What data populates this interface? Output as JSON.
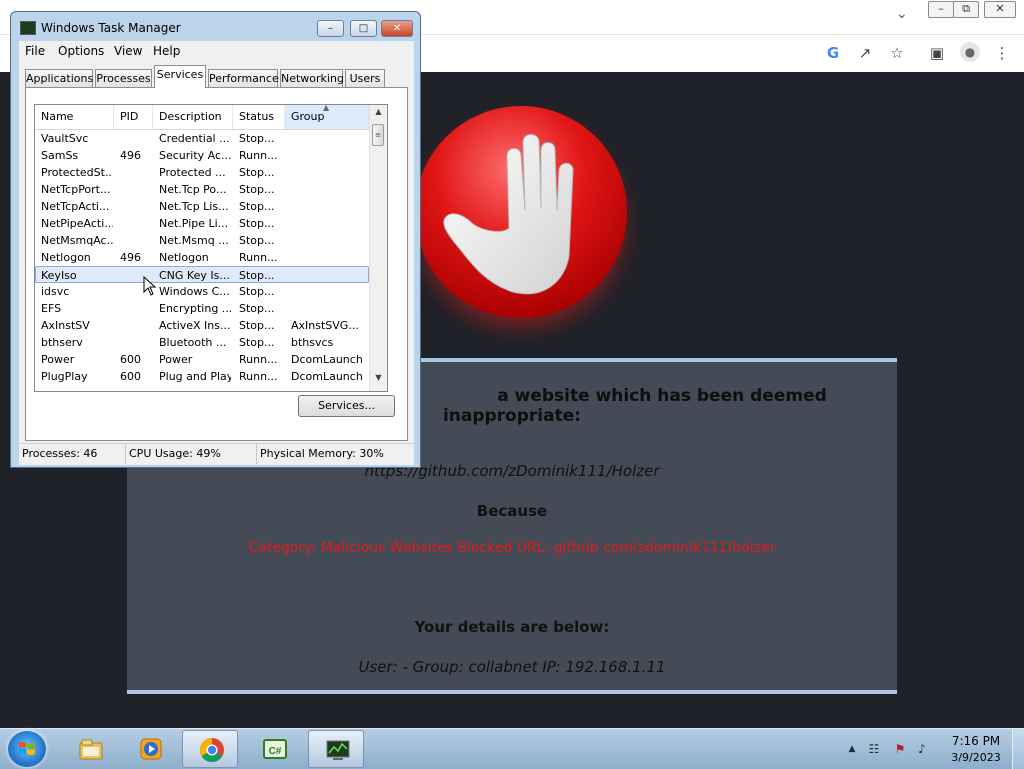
{
  "browser": {
    "window_controls": {
      "minimize": "–",
      "restore": "⧉",
      "close": "✕"
    },
    "tab_dropdown": "⌄",
    "toolbar_icons": [
      "google-icon",
      "share-icon",
      "star-icon",
      "sidepanel-icon",
      "profile-icon",
      "menu-icon"
    ],
    "toolbar_glyphs": {
      "google": "G",
      "share": "↗",
      "star": "☆",
      "sidepanel": "▣",
      "profile": "●",
      "menu": "⋮"
    }
  },
  "block_page": {
    "title": "a website which has been deemed inappropriate:",
    "url": "https://github.com/zDominik111/Holzer",
    "because": "Because",
    "reason": "Category: Malicious Websites   Blocked URL: github.com/zdominik111/holzer",
    "details_heading": "Your details are below:",
    "details": "User: -    Group: collabnet    IP: 192.168.1.11"
  },
  "task_manager": {
    "title": "Windows Task Manager",
    "menu": [
      "File",
      "Options",
      "View",
      "Help"
    ],
    "tabs": [
      "Applications",
      "Processes",
      "Services",
      "Performance",
      "Networking",
      "Users"
    ],
    "active_tab": "Services",
    "columns": [
      "Name",
      "PID",
      "Description",
      "Status",
      "Group"
    ],
    "rows": [
      {
        "name": "VaultSvc",
        "pid": "",
        "description": "Credential ...",
        "status": "Stop...",
        "group": ""
      },
      {
        "name": "SamSs",
        "pid": "496",
        "description": "Security Ac...",
        "status": "Runn...",
        "group": ""
      },
      {
        "name": "ProtectedSt...",
        "pid": "",
        "description": "Protected ...",
        "status": "Stop...",
        "group": ""
      },
      {
        "name": "NetTcpPort...",
        "pid": "",
        "description": "Net.Tcp Po...",
        "status": "Stop...",
        "group": ""
      },
      {
        "name": "NetTcpActi...",
        "pid": "",
        "description": "Net.Tcp Lis...",
        "status": "Stop...",
        "group": ""
      },
      {
        "name": "NetPipeActi...",
        "pid": "",
        "description": "Net.Pipe Li...",
        "status": "Stop...",
        "group": ""
      },
      {
        "name": "NetMsmqAc...",
        "pid": "",
        "description": "Net.Msmq ...",
        "status": "Stop...",
        "group": ""
      },
      {
        "name": "Netlogon",
        "pid": "496",
        "description": "Netlogon",
        "status": "Runn...",
        "group": ""
      },
      {
        "name": "KeyIso",
        "pid": "",
        "description": "CNG Key Is...",
        "status": "Stop...",
        "group": "",
        "selected": true
      },
      {
        "name": "idsvc",
        "pid": "",
        "description": "Windows C...",
        "status": "Stop...",
        "group": ""
      },
      {
        "name": "EFS",
        "pid": "",
        "description": "Encrypting ...",
        "status": "Stop...",
        "group": ""
      },
      {
        "name": "AxInstSV",
        "pid": "",
        "description": "ActiveX Ins...",
        "status": "Stop...",
        "group": "AxInstSVG..."
      },
      {
        "name": "bthserv",
        "pid": "",
        "description": "Bluetooth ...",
        "status": "Stop...",
        "group": "bthsvcs"
      },
      {
        "name": "Power",
        "pid": "600",
        "description": "Power",
        "status": "Runn...",
        "group": "DcomLaunch"
      },
      {
        "name": "PlugPlay",
        "pid": "600",
        "description": "Plug and Play",
        "status": "Runn...",
        "group": "DcomLaunch"
      }
    ],
    "services_button": "Services...",
    "status": {
      "processes": "Processes: 46",
      "cpu": "CPU Usage: 49%",
      "memory": "Physical Memory: 30%"
    },
    "window_buttons": {
      "minimize": "–",
      "maximize": "□",
      "close": "✕"
    }
  },
  "taskbar": {
    "apps": [
      "file-explorer-icon",
      "media-player-icon",
      "chrome-icon",
      "csharp-icon",
      "task-manager-icon"
    ],
    "csharp_label": "C#",
    "tray_arrow": "▲",
    "tray_glyphs": {
      "network": "☷",
      "flag": "⚑",
      "volume": "♪"
    },
    "clock_time": "7:16 PM",
    "clock_date": "3/9/2023"
  },
  "colors": {
    "page_bg": "#1f2228",
    "panel_bg": "#444a56",
    "reason_red": "#e01b1b",
    "stop_red": "#e01515"
  }
}
